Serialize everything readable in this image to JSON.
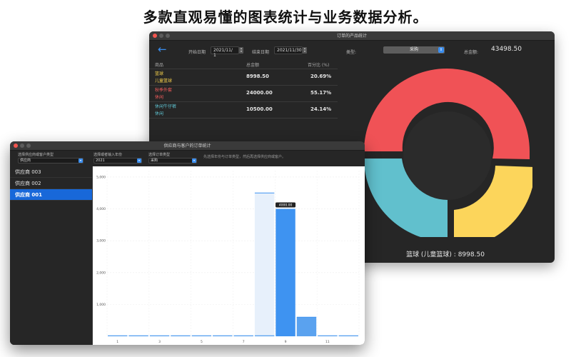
{
  "headline": "多款直观易懂的图表统计与业务数据分析。",
  "back_window": {
    "title": "订单的产品统计",
    "start_label": "开始日期",
    "start_date": "2021/11/ 1",
    "end_label": "结束日期",
    "end_date": "2021/11/30",
    "type_label": "类型:",
    "type_value": "采购",
    "total_label": "总金额:",
    "total_value": "43498.50",
    "table": {
      "headers": [
        "商品",
        "总金额",
        "百分比 (%)"
      ],
      "rows": [
        {
          "name1": "篮球",
          "name2": "儿童篮球",
          "amount": "8998.50",
          "percent": "20.69%",
          "color": "#f5d04b"
        },
        {
          "name1": "秋季外套",
          "name2": "休闲",
          "amount": "24000.00",
          "percent": "55.17%",
          "color": "#f05b5b"
        },
        {
          "name1": "休闲牛仔裤",
          "name2": "休闲",
          "amount": "10500.00",
          "percent": "24.14%",
          "color": "#5fc3d1"
        }
      ]
    },
    "donut_label": "篮球 (儿童篮球) : 8998.50",
    "donut_colors": {
      "red": "#f05256",
      "yellow": "#fcd55b",
      "teal": "#61c0cd",
      "hole": "#2b2b2b"
    }
  },
  "front_window": {
    "title": "供应商与客户的订单统计",
    "filter1_label": "选择供应商或客户类型",
    "filter1_value": "供应商",
    "filter2_label": "选择或者输入年份",
    "filter2_value": "2021",
    "filter3_label": "选择订单类型",
    "filter3_value": "采购",
    "hint": "先选择年份与订单类型，然后再选择供应商或客户。",
    "sidebar_items": [
      {
        "label": "供应商 003",
        "active": false
      },
      {
        "label": "供应商 002",
        "active": false
      },
      {
        "label": "供应商 001",
        "active": true
      }
    ]
  },
  "chart_data": {
    "type": "bar",
    "x": [
      1,
      2,
      3,
      4,
      5,
      6,
      7,
      8,
      9,
      10,
      11,
      12
    ],
    "x_tick_labels": [
      "1",
      "3",
      "5",
      "7",
      "9",
      "11"
    ],
    "y_tick_labels": [
      "1,000",
      "2,000",
      "3,000",
      "4,000",
      "5,000"
    ],
    "ylim": [
      0,
      5200
    ],
    "values": [
      0,
      0,
      0,
      0,
      0,
      0,
      0,
      0,
      4000,
      600,
      0,
      0
    ],
    "highlight_values": [
      0,
      0,
      0,
      0,
      0,
      0,
      0,
      4500,
      4000,
      600,
      0,
      0
    ],
    "tooltip": "4000.00",
    "selected_index": 8,
    "bar_color": "#3e93f1",
    "highlight_color": "#e7f0fb",
    "grid": true
  }
}
